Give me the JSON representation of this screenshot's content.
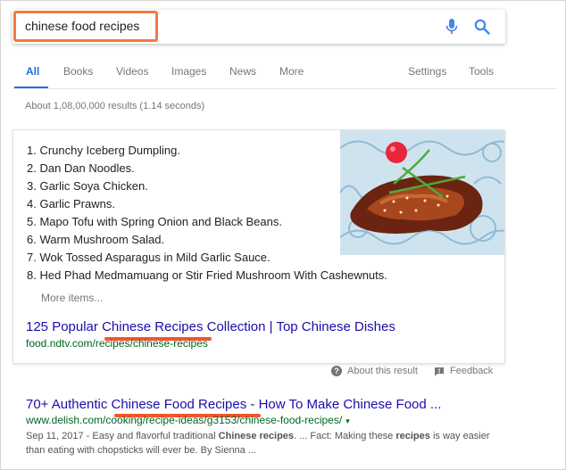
{
  "search": {
    "query": "chinese food recipes"
  },
  "tabs": {
    "all": "All",
    "books": "Books",
    "videos": "Videos",
    "images": "Images",
    "news": "News",
    "more": "More",
    "settings": "Settings",
    "tools": "Tools"
  },
  "stats": "About 1,08,00,000 results (1.14 seconds)",
  "featured": {
    "items": [
      "1. Crunchy Iceberg Dumpling.",
      "2. Dan Dan Noodles.",
      "3. Garlic Soya Chicken.",
      "4. Garlic Prawns.",
      "5. Mapo Tofu with Spring Onion and Black Beans.",
      "6. Warm Mushroom Salad.",
      "7. Wok Tossed Asparagus in Mild Garlic Sauce.",
      "8. Hed Phad Medmamuang or Stir Fried Mushroom With Cashewnuts."
    ],
    "more_items": "More items...",
    "title": "125 Popular Chinese Recipes Collection | Top Chinese Dishes",
    "url": "food.ndtv.com/recipes/chinese-recipes"
  },
  "about_result": "About this result",
  "feedback": "Feedback",
  "result2": {
    "title": "70+ Authentic Chinese Food Recipes - How To Make Chinese Food ...",
    "url": "www.delish.com/cooking/recipe-ideas/g3153/chinese-food-recipes/",
    "caret": "▾",
    "date": "Sep 11, 2017 - ",
    "snippet_a": "Easy and flavorful traditional ",
    "snippet_b1": "Chinese recipes",
    "snippet_c": ". ... Fact: Making these ",
    "snippet_b2": "recipes",
    "snippet_d": " is way easier than eating with chopsticks will ever be. By Sienna ..."
  },
  "colors": {
    "accent": "#1a73e8",
    "link": "#1a0dab",
    "url": "#006621",
    "annotation": "#f47a43"
  }
}
